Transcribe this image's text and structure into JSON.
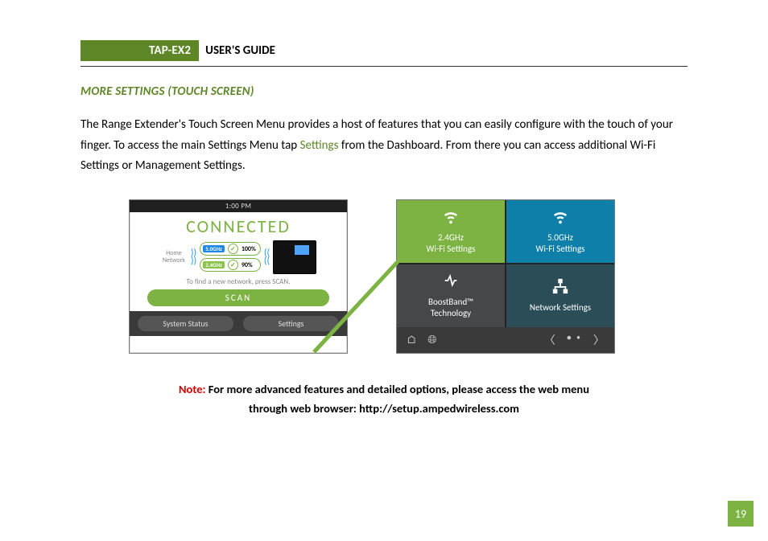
{
  "header": {
    "product": "TAP-EX2",
    "title": "USER'S GUIDE"
  },
  "section_heading": "MORE SETTINGS (TOUCH SCREEN)",
  "body": {
    "part1": "The Range Extender's Touch Screen Menu provides a host of features that you can easily configure with the touch of your finger. To access the main Settings Menu tap ",
    "keyword": "Settings",
    "part2": " from the Dashboard. From there you can access additional Wi-Fi Settings or Management Settings."
  },
  "dashboard": {
    "time": "1:00 PM",
    "status": "CONNECTED",
    "home_label": "Home Network",
    "band1": {
      "ghz": "5.0GHz",
      "pct": "100%"
    },
    "band2": {
      "ghz": "2.4GHz",
      "pct": "90%"
    },
    "hint": "To find a new network, press SCAN.",
    "scan": "SCAN",
    "tab_status": "System Status",
    "tab_settings": "Settings"
  },
  "settings_tiles": {
    "t1": {
      "l1": "2.4GHz",
      "l2": "Wi-Fi Settings"
    },
    "t2": {
      "l1": "5.0GHz",
      "l2": "Wi-Fi Settings"
    },
    "t3": {
      "l1": "BoostBand™",
      "l2": "Technology"
    },
    "t4": {
      "l1": "Network Settings"
    }
  },
  "note": {
    "label": "Note:",
    "line1": " For more advanced features and detailed options, please access the web menu",
    "line2": "through web browser: http://setup.ampedwireless.com"
  },
  "page_number": "19"
}
